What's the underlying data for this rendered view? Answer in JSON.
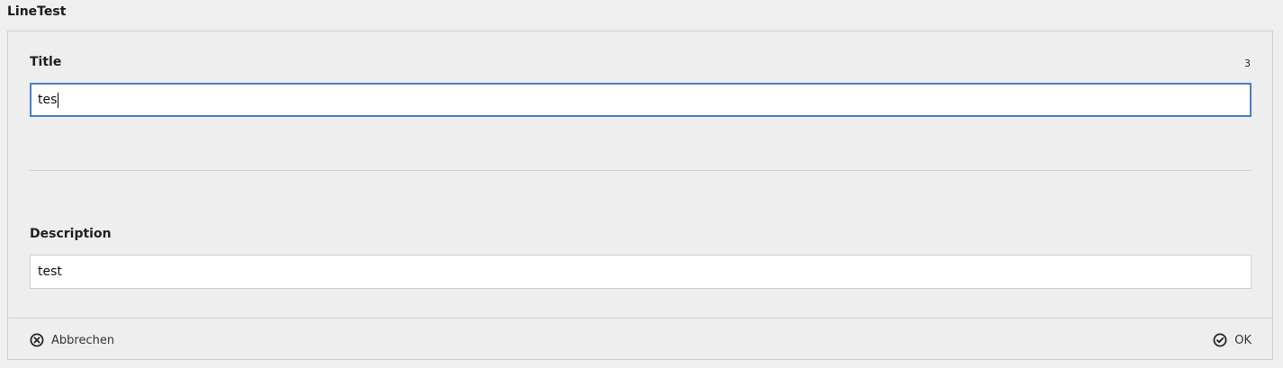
{
  "window": {
    "title": "LineTest"
  },
  "form": {
    "title_label": "Title",
    "title_char_count": "3",
    "title_value": "tes",
    "description_label": "Description",
    "description_value": "test"
  },
  "footer": {
    "cancel_label": "Abbrechen",
    "cancel_icon": "close-circle-icon",
    "ok_label": "OK",
    "ok_icon": "check-circle-icon"
  },
  "colors": {
    "focus_border": "#4a7ec9",
    "background": "#eeeeee"
  }
}
